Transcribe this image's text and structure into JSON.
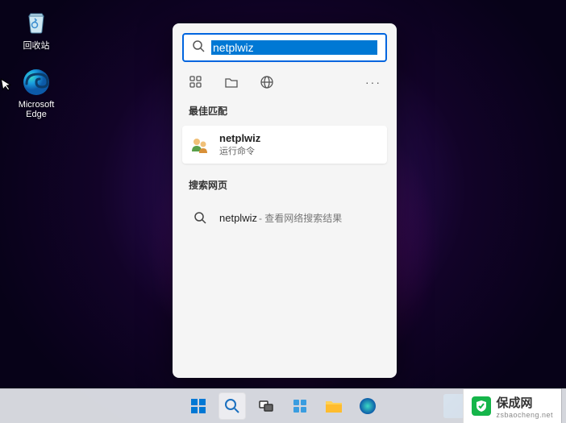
{
  "desktop": {
    "icons": {
      "recycle_bin": "回收站",
      "edge": "Microsoft\nEdge"
    }
  },
  "search": {
    "query": "netplwiz",
    "sections": {
      "best_match": "最佳匹配",
      "web": "搜索网页"
    },
    "best_result": {
      "title": "netplwiz",
      "subtitle": "运行命令"
    },
    "web_result": {
      "title": "netplwiz",
      "suffix": " - 查看网络搜索结果"
    }
  },
  "watermark": {
    "brand": "保成网",
    "url": "zsbaocheng.net"
  }
}
